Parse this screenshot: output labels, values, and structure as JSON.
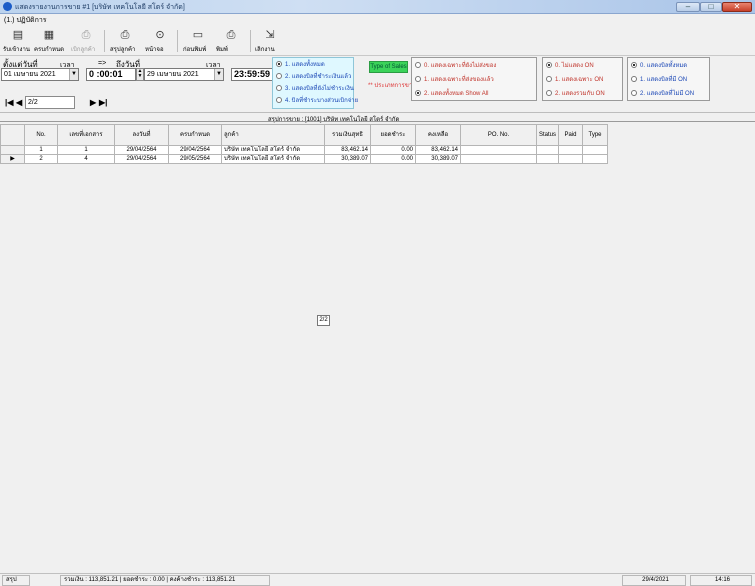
{
  "window": {
    "title": "แสดงรายงานการขาย #1 [บริษัท เทคโนโลยี สโตร์ จำกัด]",
    "controls": [
      "–",
      "□",
      "✕"
    ]
  },
  "menu": {
    "label": "(1.) ปฏิบัติการ"
  },
  "toolbar": {
    "buttons": [
      {
        "icon": "list-icon",
        "glyph": "▤",
        "label": "รับเข้างาน"
      },
      {
        "icon": "grid-icon",
        "glyph": "▦",
        "label": "ครบกำหนด"
      },
      {
        "icon": "print-disabled-icon",
        "glyph": "⎙",
        "label": "เบิกลูกค้า"
      },
      {
        "icon": "print-icon",
        "glyph": "⎙",
        "label": "สรุปลูกค้า"
      },
      {
        "icon": "binoculars-icon",
        "glyph": "⊙",
        "label": "หน้าจอ"
      },
      {
        "icon": "preview-icon",
        "glyph": "▭",
        "label": "ก่อนพิมพ์"
      },
      {
        "icon": "printer-icon",
        "glyph": "⎙",
        "label": "พิมพ์"
      },
      {
        "icon": "exit-icon",
        "glyph": "⇲",
        "label": "เลิกงาน"
      }
    ]
  },
  "filter": {
    "from_label": "ตั้งแต่วันที่",
    "time_label": "เวลา",
    "arrow": "=>",
    "to_label": "ถึงวันที่",
    "time_label2": "เวลา",
    "from_date": "01  เมษายน  2021",
    "from_time": "0 :00:01",
    "to_date": "29  เมษายน  2021",
    "to_time": "23:59:59",
    "nav_first": "|◀",
    "nav_prev": "◀",
    "nav_page": "2/2",
    "nav_next": "▶",
    "nav_last": "▶|",
    "type_of_sales": "Type of Sales",
    "sales_note": "** ประเภทการขาย **"
  },
  "radios": {
    "group1": [
      "1. แสดงทั้งหมด",
      "2. แสดงบิลที่ชำระเงินแล้ว",
      "3. แสดงบิลที่ยังไม่ชำระเงิน",
      "4. บิลที่ชำระบางส่วนเบิกจ่าย"
    ],
    "group2": [
      "0. แสดงเฉพาะที่ยังไม่ส่งของ",
      "1. แสดงเฉพาะที่ส่งของแล้ว",
      "2. แสดงทั้งหมด Show All"
    ],
    "group3": [
      "0. ไม่แสดง ON",
      "1. แสดงเฉพาะ ON",
      "2. แสดงรวมกับ ON"
    ],
    "group4": [
      "0. แสดงบิลทั้งหมด",
      "1. แสดงบิลที่มี ON",
      "2. แสดงบิลที่ไม่มี ON"
    ]
  },
  "grid": {
    "caption": "สรุปการขาย : [1001] บริษัท เทคโนโลยี สโตร์ จำกัด",
    "columns": [
      "No.",
      "เลขที่เอกสาร",
      "ลงวันที่",
      "ครบกำหนด",
      "ลูกค้า",
      "รวมเงินสุทธิ",
      "ยอดชำระ",
      "คงเหลือ",
      "PO. No.",
      "Status",
      "Paid",
      "Type"
    ],
    "rows": [
      {
        "marker": "",
        "no": "1",
        "doc": "1",
        "date": "29/04/2564",
        "due": "29/04/2564",
        "customer": "บริษัท เทคโนโลยี สโตร์ จำกัด",
        "total": "83,462.14",
        "paid": "0.00",
        "balance": "83,462.14"
      },
      {
        "marker": "▶",
        "no": "2",
        "doc": "4",
        "date": "29/04/2564",
        "due": "29/05/2564",
        "customer": "บริษัท เทคโนโลยี สโตร์ จำกัด",
        "total": "30,389.07",
        "paid": "0.00",
        "balance": "30,389.07"
      }
    ],
    "page_indicator": "2/2"
  },
  "status": {
    "summary_label": "สรุป",
    "summary": "รวมเงิน : 113,851.21  | ยอดชำระ : 0.00  | คงค้างชำระ : 113,851.21",
    "date": "29/4/2021",
    "time": "14:16"
  }
}
